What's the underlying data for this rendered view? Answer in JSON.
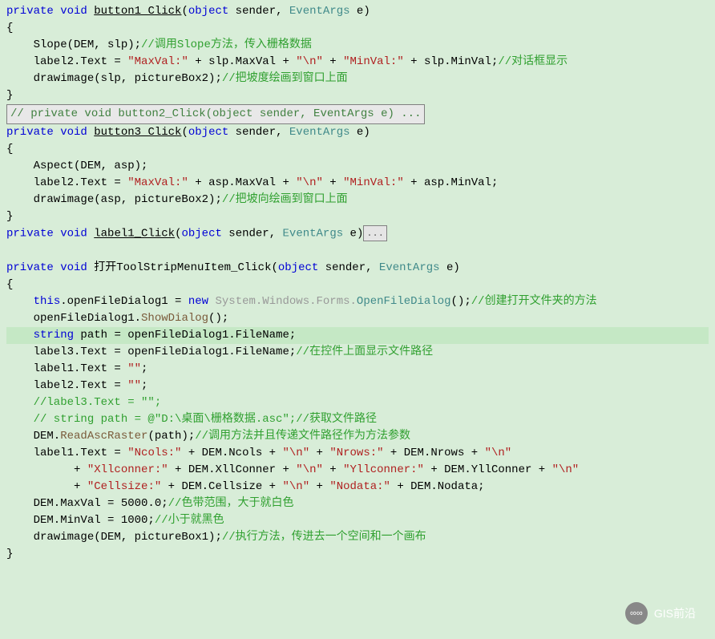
{
  "code": {
    "l1_kw1": "private",
    "l1_kw2": "void",
    "l1_method": "button1_Click",
    "l1_p": "(",
    "l1_kw3": "object",
    "l1_sender": " sender, ",
    "l1_type": "EventArgs",
    "l1_e": " e)",
    "l2": "{",
    "l3_call": "    Slope(DEM, slp);",
    "l3_comment": "//调用Slope方法，传入栅格数据",
    "l4_a": "    label2.Text = ",
    "l4_s1": "\"MaxVal:\"",
    "l4_b": " + slp.MaxVal + ",
    "l4_s2": "\"\\n\"",
    "l4_c": " + ",
    "l4_s3": "\"MinVal:\"",
    "l4_d": " + slp.MinVal;",
    "l4_comment": "//对话框显示",
    "l5_a": "    drawimage(slp, pictureBox2);",
    "l5_comment": "//把坡度绘画到窗口上面",
    "l6": "}",
    "l7_fold": "// private void button2_Click(object sender, EventArgs e) ...",
    "l8_kw1": "private",
    "l8_kw2": "void",
    "l8_method": "button3_Click",
    "l8_p": "(",
    "l8_kw3": "object",
    "l8_sender": " sender, ",
    "l8_type": "EventArgs",
    "l8_e": " e)",
    "l9": "{",
    "l10": "    Aspect(DEM, asp);",
    "l11_a": "    label2.Text = ",
    "l11_s1": "\"MaxVal:\"",
    "l11_b": " + asp.MaxVal + ",
    "l11_s2": "\"\\n\"",
    "l11_c": " + ",
    "l11_s3": "\"MinVal:\"",
    "l11_d": " + asp.MinVal;",
    "l12_a": "    drawimage(asp, pictureBox2);",
    "l12_comment": "//把坡向绘画到窗口上面",
    "l13": "}",
    "l14_kw1": "private",
    "l14_kw2": "void",
    "l14_method": "label1_Click",
    "l14_p": "(",
    "l14_kw3": "object",
    "l14_sender": " sender, ",
    "l14_type": "EventArgs",
    "l14_e": " e)",
    "l14_fold": "...",
    "l16_kw1": "private",
    "l16_kw2": "void",
    "l16_method": "打开ToolStripMenuItem_Click",
    "l16_p": "(",
    "l16_kw3": "object",
    "l16_sender": " sender, ",
    "l16_type": "EventArgs",
    "l16_e": " e)",
    "l17": "{",
    "l18_a": "    ",
    "l18_this": "this",
    "l18_b": ".openFileDialog1 = ",
    "l18_new": "new",
    "l18_c": " ",
    "l18_ns": "System.Windows.Forms.",
    "l18_cls": "OpenFileDialog",
    "l18_d": "();",
    "l18_comment": "//创建打开文件夹的方法",
    "l19_a": "    openFileDialog1.",
    "l19_m": "ShowDialog",
    "l19_b": "();",
    "l20_a": "    ",
    "l20_kw": "string",
    "l20_b": " path = openFileDialog1.FileName;",
    "l21_a": "    label3.Text = openFileDialog1.FileName;",
    "l21_comment": "//在控件上面显示文件路径",
    "l22_a": "    label1.Text = ",
    "l22_s": "\"\"",
    "l22_b": ";",
    "l23_a": "    label2.Text = ",
    "l23_s": "\"\"",
    "l23_b": ";",
    "l24_comment": "    //label3.Text = \"\";",
    "l25_comment": "    // string path = @\"D:\\桌面\\栅格数据.asc\";//获取文件路径",
    "l26_a": "    DEM.",
    "l26_m": "ReadAscRaster",
    "l26_b": "(path);",
    "l26_comment": "//调用方法并且传递文件路径作为方法参数",
    "l27_a": "    label1.Text = ",
    "l27_s1": "\"Ncols:\"",
    "l27_b": " + DEM.Ncols + ",
    "l27_s2": "\"\\n\"",
    "l27_c": " + ",
    "l27_s3": "\"Nrows:\"",
    "l27_d": " + DEM.Nrows + ",
    "l27_s4": "\"\\n\"",
    "l28_a": "          + ",
    "l28_s1": "\"Xllconner:\"",
    "l28_b": " + DEM.XllConner + ",
    "l28_s2": "\"\\n\"",
    "l28_c": " + ",
    "l28_s3": "\"Yllconner:\"",
    "l28_d": " + DEM.YllConner + ",
    "l28_s4": "\"\\n\"",
    "l29_a": "          + ",
    "l29_s1": "\"Cellsize:\"",
    "l29_b": " + DEM.Cellsize + ",
    "l29_s2": "\"\\n\"",
    "l29_c": " + ",
    "l29_s3": "\"Nodata:\"",
    "l29_d": " + DEM.Nodata;",
    "l30_a": "    DEM.MaxVal = 5000.0;",
    "l30_comment": "//色带范围，大于就白色",
    "l31_a": "    DEM.MinVal = 1000;",
    "l31_comment": "//小于就黑色",
    "l32_a": "    drawimage(DEM, pictureBox1);",
    "l32_comment": "//执行方法，传进去一个空间和一个画布",
    "l33": "}"
  },
  "watermark": {
    "text": "GIS前沿",
    "icon": "∞∞"
  }
}
